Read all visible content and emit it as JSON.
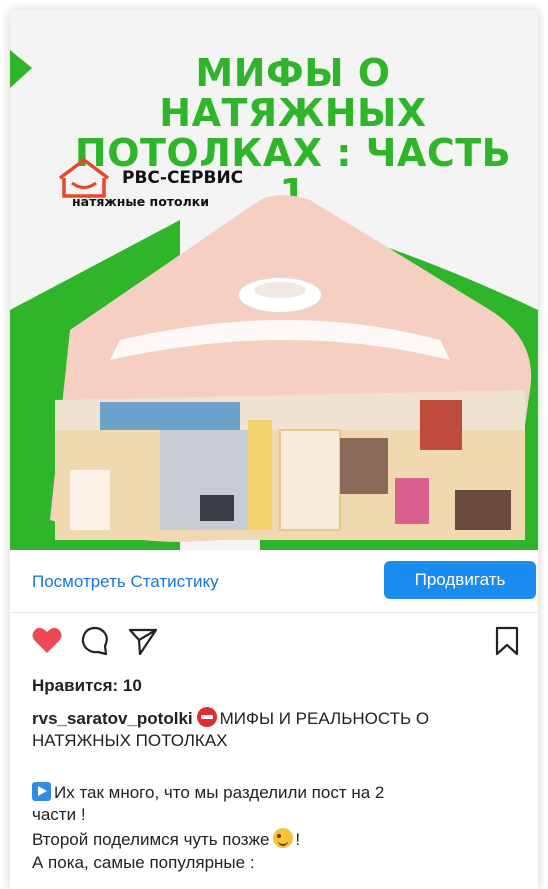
{
  "post_image": {
    "headline_line1": "МИФЫ О НАТЯЖНЫХ",
    "headline_line2": "ПОТОЛКАХ : ЧАСТЬ 1",
    "logo_name": "РВС-СЕРВИС",
    "logo_sub": "натяжные потолки",
    "accent_color": "#2fb52a"
  },
  "stats": {
    "link_label": "Посмотреть Статистику",
    "promote_label": "Продвигать"
  },
  "actions": {
    "like_icon": "heart-icon",
    "comment_icon": "comment-icon",
    "share_icon": "send-icon",
    "save_icon": "bookmark-icon",
    "liked": true
  },
  "likes_text": "Нравится: 10",
  "caption": {
    "username": "rvs_saratov_potolki",
    "line1": "МИФЫ И РЕАЛЬНОСТЬ О",
    "line2": "НАТЯЖНЫХ ПОТОЛКАХ",
    "para1_line1": "Их так много, что мы разделили пост на 2",
    "para1_line2": "части !",
    "para2_a": "Второй поделимся чуть позже",
    "para2_b": "!",
    "para3": "А пока, самые популярные :"
  }
}
